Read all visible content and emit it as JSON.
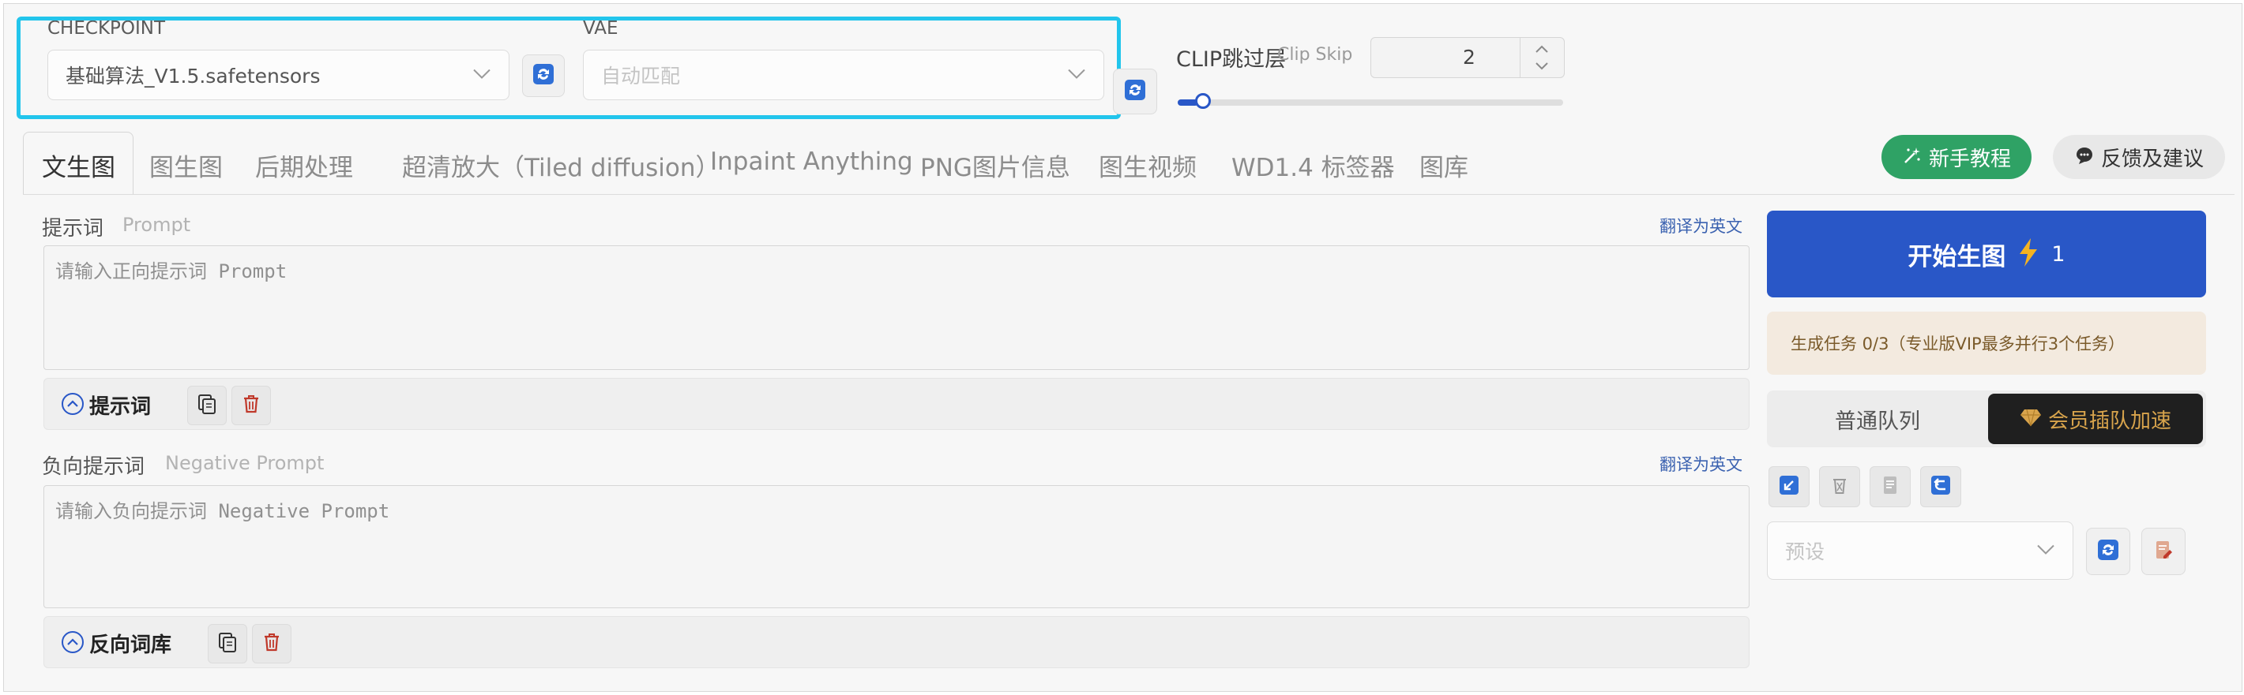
{
  "model": {
    "checkpoint_label": "CHECKPOINT",
    "checkpoint_value": "基础算法_V1.5.safetensors",
    "vae_label": "VAE",
    "vae_placeholder": "自动匹配",
    "clip_label": "CLIP跳过层",
    "clip_sub_label": "Clip Skip",
    "clip_value": "2",
    "clip_fraction": 0.02
  },
  "tabs": [
    {
      "label": "文生图"
    },
    {
      "label": "图生图"
    },
    {
      "label": "后期处理"
    },
    {
      "label": "超清放大（Tiled diffusion）"
    },
    {
      "label": "Inpaint Anything"
    },
    {
      "label": "PNG图片信息"
    },
    {
      "label": "图生视频"
    },
    {
      "label": "WD1.4 标签器"
    },
    {
      "label": "图库"
    }
  ],
  "header_buttons": {
    "tutorial": "新手教程",
    "feedback": "反馈及建议"
  },
  "prompt": {
    "label": "提示词",
    "sub_label": "Prompt",
    "translate": "翻译为英文",
    "placeholder": "请输入正向提示词 Prompt",
    "toggle_label": "提示词"
  },
  "negative": {
    "label": "负向提示词",
    "sub_label": "Negative Prompt",
    "translate": "翻译为英文",
    "placeholder": "请输入负向提示词 Negative Prompt",
    "toggle_label": "反向词库"
  },
  "generate": {
    "label": "开始生图",
    "cost": "1",
    "task_status": "生成任务 0/3（专业版VIP最多并行3个任务）",
    "queue_normal": "普通队列",
    "queue_vip": "会员插队加速",
    "preset_placeholder": "预设"
  },
  "colors": {
    "accent_blue": "#2957c7",
    "highlight_cyan": "#22c5ec",
    "green": "#2fa265",
    "delete_red": "#c0392b",
    "gold": "#d8a44c"
  }
}
